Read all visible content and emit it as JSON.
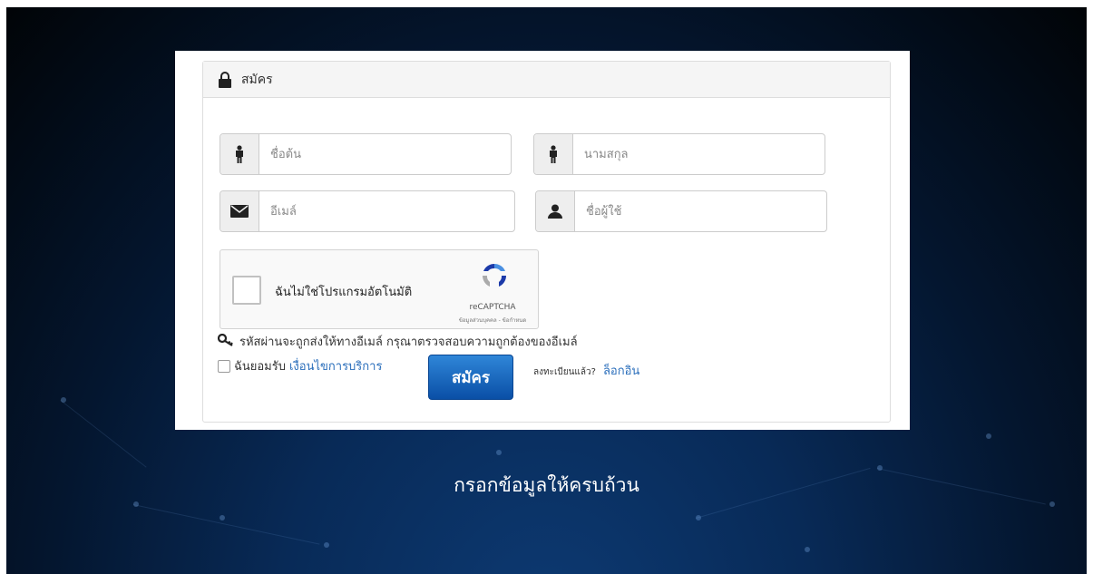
{
  "panel": {
    "title": "สมัคร"
  },
  "form": {
    "first_name_placeholder": "ชื่อต้น",
    "last_name_placeholder": "นามสกุล",
    "email_placeholder": "อีเมล์",
    "username_placeholder": "ชื่อผู้ใช้"
  },
  "recaptcha": {
    "label": "ฉันไม่ใช่โปรแกรมอัตโนมัติ",
    "brand": "reCAPTCHA",
    "terms": "ข้อมูลส่วนบุคคล - ข้อกำหนด"
  },
  "hint": "รหัสผ่านจะถูกส่งให้ทางอีเมล์ กรุณาตรวจสอบความถูกต้องของอีเมล์",
  "agree": {
    "prefix": "ฉันยอมรับ",
    "link": "เงื่อนไขการบริการ"
  },
  "submit_label": "สมัคร",
  "already": {
    "text": "ลงทะเบียนแล้ว?",
    "login": "ล็อกอิน"
  },
  "caption": "กรอกข้อมูลให้ครบถ้วน",
  "colors": {
    "accent": "#2a6ebb",
    "button_top": "#2f86d8",
    "button_bottom": "#0a4fa6",
    "background_dark": "#010407",
    "background_blue": "#0d3a73"
  }
}
